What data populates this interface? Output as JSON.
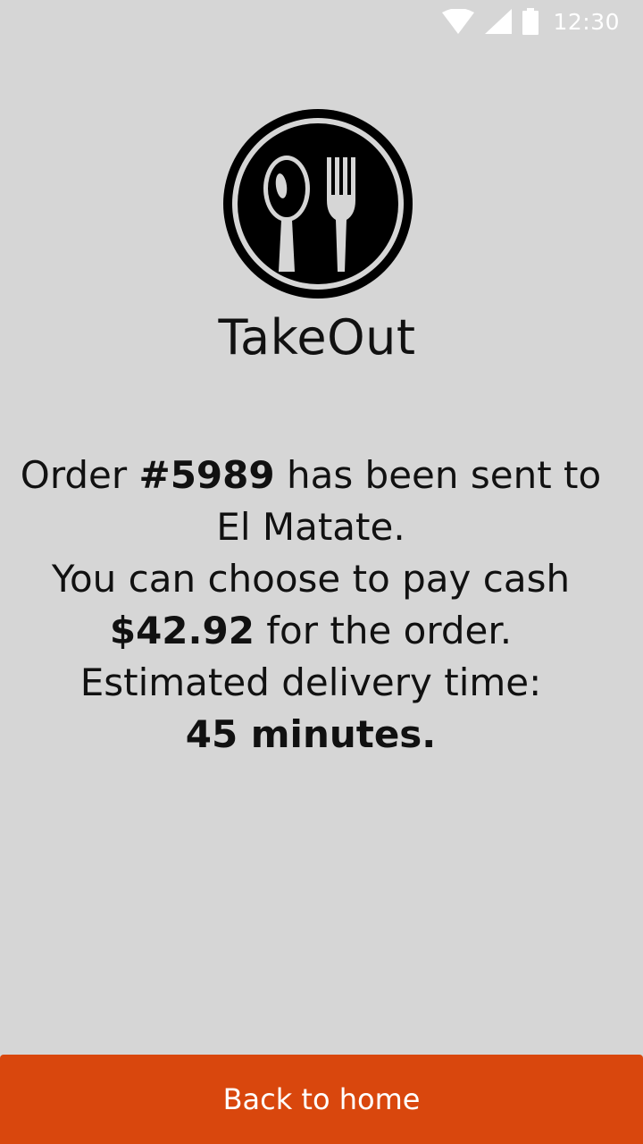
{
  "status_bar": {
    "time": "12:30",
    "icons": [
      "wifi-icon",
      "cellular-signal-icon",
      "battery-icon"
    ]
  },
  "app": {
    "name": "TakeOut",
    "logo_icon": "spoon-fork-icon"
  },
  "confirmation": {
    "order_prefix": "Order ",
    "order_number": "#5989",
    "order_suffix": " has been sent to",
    "restaurant": "El Matate.",
    "payment_text": "You can choose to pay cash",
    "amount": "$42.92",
    "amount_suffix": " for the order.",
    "delivery_label": "Estimated delivery time:",
    "delivery_time": "45 minutes."
  },
  "actions": {
    "back_label": "Back to home"
  },
  "colors": {
    "background": "#d6d6d6",
    "accent": "#d9470d",
    "text": "#111111",
    "status_icons": "#ffffff"
  }
}
